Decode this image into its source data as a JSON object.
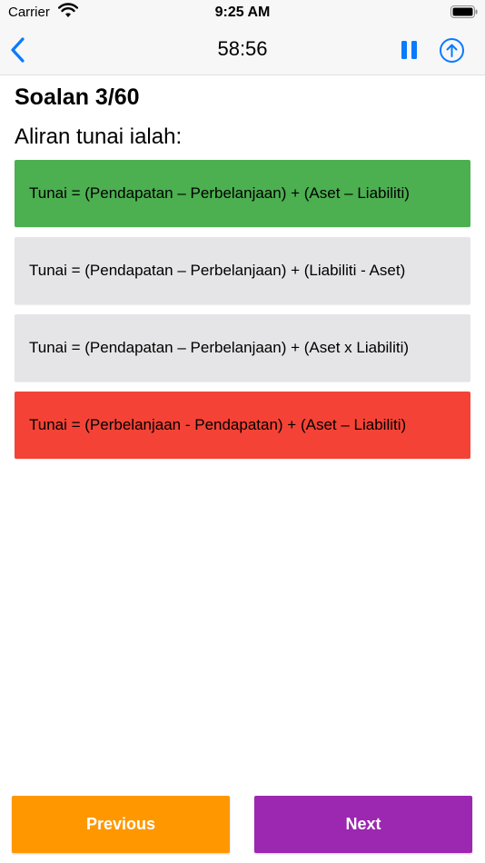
{
  "status_bar": {
    "carrier": "Carrier",
    "time": "9:25 AM",
    "icons": [
      "wifi-icon",
      "battery-icon"
    ]
  },
  "nav": {
    "timer": "58:56",
    "icons": [
      "back-chevron-icon",
      "pause-icon",
      "upload-circle-icon"
    ],
    "accent_color": "#0a7aff"
  },
  "question": {
    "number": "Soalan 3/60",
    "text": "Aliran tunai ialah:"
  },
  "answers": [
    {
      "text": "Tunai = (Pendapatan – Perbelanjaan) + (Aset – Liabiliti)",
      "state": "correct"
    },
    {
      "text": "Tunai = (Pendapatan – Perbelanjaan) + (Liabiliti - Aset)",
      "state": "neutral"
    },
    {
      "text": "Tunai = (Pendapatan – Perbelanjaan) + (Aset x Liabiliti)",
      "state": "neutral"
    },
    {
      "text": "Tunai = (Perbelanjaan - Pendapatan) + (Aset – Liabiliti)",
      "state": "wrong"
    }
  ],
  "answer_colors": {
    "correct": "#4caf50",
    "neutral": "#e5e5e7",
    "wrong": "#f44336"
  },
  "footer": {
    "previous_label": "Previous",
    "next_label": "Next",
    "previous_color": "#ff9800",
    "next_color": "#9c27b0"
  }
}
